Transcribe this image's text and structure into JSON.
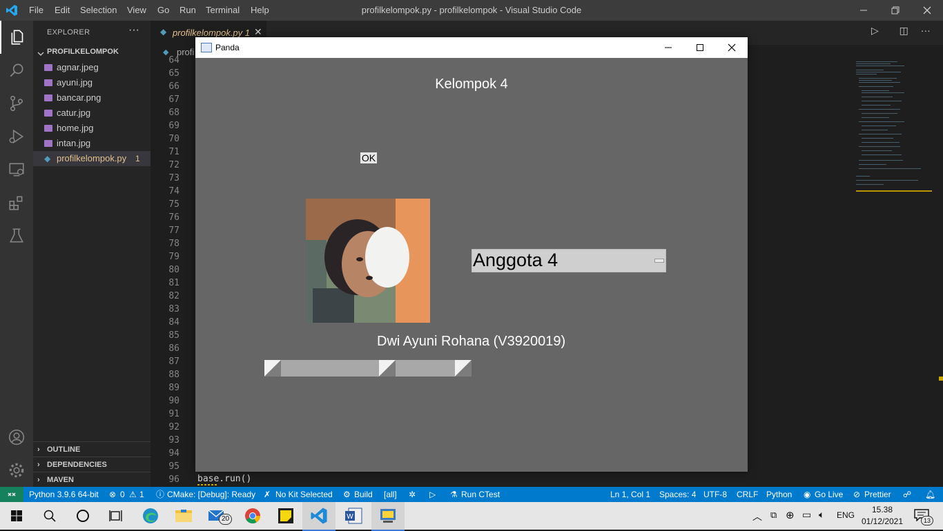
{
  "titlebar": {
    "menu": [
      "File",
      "Edit",
      "Selection",
      "View",
      "Go",
      "Run",
      "Terminal",
      "Help"
    ],
    "title": "profilkelompok.py - profilkelompok - Visual Studio Code"
  },
  "sidebar": {
    "title": "EXPLORER",
    "more": "···",
    "folder": "PROFILKELOMPOK",
    "files": [
      {
        "name": "agnar.jpeg"
      },
      {
        "name": "ayuni.jpg"
      },
      {
        "name": "bancar.png"
      },
      {
        "name": "catur.jpg"
      },
      {
        "name": "home.jpg"
      },
      {
        "name": "intan.jpg"
      },
      {
        "name": "profilkelompok.py",
        "badge": "1"
      }
    ],
    "panels": [
      "OUTLINE",
      "DEPENDENCIES",
      "MAVEN"
    ]
  },
  "editor": {
    "tab": "profilkelompok.py 1",
    "breadcrumb": "profi",
    "line_numbers": [
      "64",
      "65",
      "66",
      "67",
      "68",
      "69",
      "70",
      "71",
      "72",
      "73",
      "74",
      "75",
      "76",
      "77",
      "78",
      "79",
      "80",
      "81",
      "82",
      "83",
      "84",
      "85",
      "86",
      "87",
      "88",
      "89",
      "90",
      "91",
      "92",
      "93",
      "94",
      "95",
      "96"
    ],
    "last_code_line": "base.run()"
  },
  "panda_window": {
    "title": "Panda",
    "heading": "Kelompok 4",
    "ok_button": "OK",
    "menu_label": "Anggota 4",
    "member_name": "Dwi Ayuni Rohana (V3920019)"
  },
  "statusbar": {
    "python": "Python 3.9.6 64-bit",
    "errors": "0",
    "warnings": "1",
    "cmake": "CMake: [Debug]: Ready",
    "kit": "No Kit Selected",
    "build": "Build",
    "target": "[all]",
    "run_ctest": "Run CTest",
    "position": "Ln 1, Col 1",
    "spaces": "Spaces: 4",
    "encoding": "UTF-8",
    "eol": "CRLF",
    "language": "Python",
    "golive": "Go Live",
    "prettier": "Prettier"
  },
  "taskbar": {
    "mail_badge": "20",
    "lang": "ENG",
    "time": "15.38",
    "date": "01/12/2021",
    "notif_count": "13"
  },
  "colors": {
    "accent": "#007acc",
    "panda_bg": "#666666",
    "modified_file": "#e2c08d"
  }
}
